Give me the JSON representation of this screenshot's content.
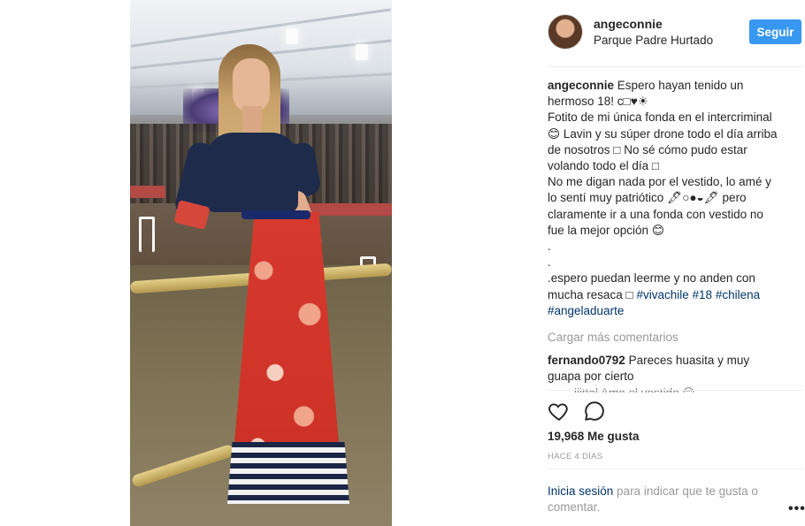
{
  "post": {
    "username": "angeconnie",
    "location": "Parque Padre Hurtado",
    "follow_label": "Seguir",
    "avatar_icon": "avatar-photo"
  },
  "caption": {
    "username": "angeconnie",
    "line1": "Espero hayan tenido un",
    "line2": "hermoso 18! c□♥☀",
    "line3": "Fotito de mi única fonda en el intercriminal",
    "line4": "😊 Lavin y su súper drone todo el día arriba",
    "line5": "de nosotros □ No sé cómo pudo estar",
    "line6": "volando todo el día □",
    "line7": "No me digan nada por el vestido, lo amé y",
    "line8": "lo sentí muy patriótico 🖋○●◒🖋 pero",
    "line9": "claramente ir a una fonda con vestido no",
    "line10": "fue la mejor opción 😊",
    "dot1": ".",
    "dot2": ".",
    "line11": ".espero puedan leerme y no anden con",
    "line12": "mucha resaca □",
    "tags_line1": [
      "#vivachile",
      "#18",
      "#chilena"
    ],
    "tags_line2": "#angeladuarte"
  },
  "more_comments_label": "Cargar más comentarios",
  "comment2": {
    "username": "fernando0792",
    "text_a": "Pareces huasita y muy",
    "text_b": "guapa por cierto"
  },
  "comment3_partial": "____iiittal  Amo el vestido 😊",
  "actions": {
    "like_icon": "heart-icon",
    "comment_icon": "comment-icon"
  },
  "likes_label": "19,968 Me gusta",
  "timestamp": "HACE 4 DÍAS",
  "login": {
    "link": "Inicia sesión",
    "text": " para indicar que te gusta o comentar."
  },
  "more_options_icon": "•••",
  "colors": {
    "accent": "#3897f0",
    "link": "#003569",
    "muted": "#999999"
  }
}
